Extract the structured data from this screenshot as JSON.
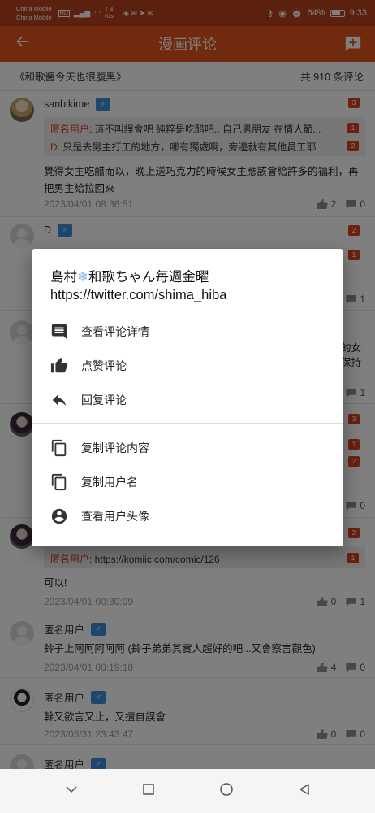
{
  "status_bar": {
    "carrier1": "China Mobile",
    "carrier2": "China Mobile",
    "hd": "HD",
    "net_speed": "1.4 K/s",
    "battery": "64%",
    "time": "9:33"
  },
  "app_bar": {
    "title": "漫画评论"
  },
  "subheader": {
    "comic_title": "《和歌酱今天也很腹黑》",
    "total": "共 910 条评论"
  },
  "comments": [
    {
      "user": "sanbikime",
      "gender": "♂",
      "floor": "3",
      "quotes": [
        {
          "who": "匿名用户",
          "text": ": 這不叫誤會吧  純粹是吃醋吧..  自己男朋友 在情人節...",
          "floor": "1"
        },
        {
          "who": "D",
          "text": ": 只是去男主打工的地方，哪有獨處啊，旁邊就有其他員工耶",
          "floor": "2"
        }
      ],
      "body": "覺得女主吃醋而以，晚上送巧克力的時候女主應該會給許多的福利，再把男主給拉回來",
      "time": "2023/04/01 08:36:51",
      "likes": "2",
      "replies": "0"
    },
    {
      "user": "D",
      "gender": "♂",
      "floor": "2",
      "quote_floor": "1",
      "replies": "1"
    },
    {
      "body_fragment": "的女",
      "body_fragment2": "保持",
      "replies": "1"
    },
    {
      "floor": "3",
      "quote_floors": [
        "1",
        "2"
      ],
      "replies": "0"
    },
    {
      "floor": "2",
      "quotes": [
        {
          "who": "匿名用户",
          "text": ": https://komiic.com/comic/126",
          "floor": "1"
        }
      ],
      "body": "可以!",
      "time": "2023/04/01 00:30:09",
      "likes": "0",
      "replies": "1"
    },
    {
      "user": "匿名用户",
      "gender": "♂",
      "body": "鈴子上阿阿阿阿阿 (鈴子弟弟其實人超好的吧...又會察言觀色)",
      "time": "2023/04/01 00:19:18",
      "likes": "4",
      "replies": "0"
    },
    {
      "user": "匿名用户",
      "gender": "♂",
      "body": "幹又欲言又止，又擅自誤會",
      "time": "2023/03/31 23:43:47",
      "likes": "0",
      "replies": "0"
    },
    {
      "user": "匿名用户",
      "gender": "♂"
    }
  ],
  "dialog": {
    "title_part1": "島村",
    "title_emoji": "❄",
    "title_part2": "和歌ちゃん毎週金曜",
    "title_line2": "https://twitter.com/shima_hiba",
    "options": [
      {
        "label": "查看评论详情",
        "icon": "comment-icon"
      },
      {
        "label": "点赞评论",
        "icon": "thumb-up-icon"
      },
      {
        "label": "回复评论",
        "icon": "reply-icon"
      },
      {
        "label": "复制评论内容",
        "icon": "copy-icon"
      },
      {
        "label": "复制用户名",
        "icon": "copy-icon"
      },
      {
        "label": "查看用户头像",
        "icon": "account-circle-icon"
      }
    ]
  },
  "colors": {
    "primary": "#e5551f",
    "status_bar": "#b8421c",
    "badge": "#d8431c",
    "gender": "#3a8fd9"
  }
}
